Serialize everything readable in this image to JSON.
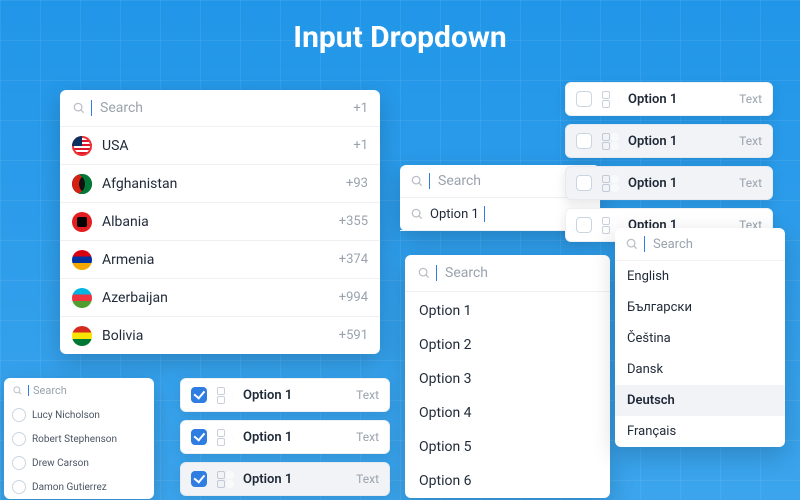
{
  "title": "Input Dropdown",
  "countries": {
    "placeholder": "Search",
    "search_code": "+1",
    "items": [
      {
        "name": "USA",
        "code": "+1"
      },
      {
        "name": "Afghanistan",
        "code": "+93"
      },
      {
        "name": "Albania",
        "code": "+355"
      },
      {
        "name": "Armenia",
        "code": "+374"
      },
      {
        "name": "Azerbaijan",
        "code": "+994"
      },
      {
        "name": "Bolivia",
        "code": "+591"
      }
    ]
  },
  "mini": {
    "placeholder": "Search",
    "typed": "Option 1"
  },
  "generic": {
    "placeholder": "Search",
    "items": [
      "Option 1",
      "Option 2",
      "Option 3",
      "Option 4",
      "Option 5",
      "Option 6"
    ]
  },
  "check": {
    "label": "Option 1",
    "trailing": "Text",
    "top": [
      {
        "checked": false,
        "selected": false
      },
      {
        "checked": false,
        "selected": true
      },
      {
        "checked": false,
        "selected": true
      },
      {
        "checked": false,
        "selected": false
      }
    ],
    "bottom": [
      {
        "checked": true,
        "selected": false
      },
      {
        "checked": true,
        "selected": false
      },
      {
        "checked": true,
        "selected": true
      }
    ]
  },
  "lang": {
    "placeholder": "Search",
    "items": [
      "English",
      "Български",
      "Čeština",
      "Dansk",
      "Deutsch",
      "Français"
    ],
    "selected_index": 4
  },
  "people": {
    "placeholder": "Search",
    "items": [
      "Lucy Nicholson",
      "Robert Stephenson",
      "Drew Carson",
      "Damon Gutierrez"
    ]
  }
}
